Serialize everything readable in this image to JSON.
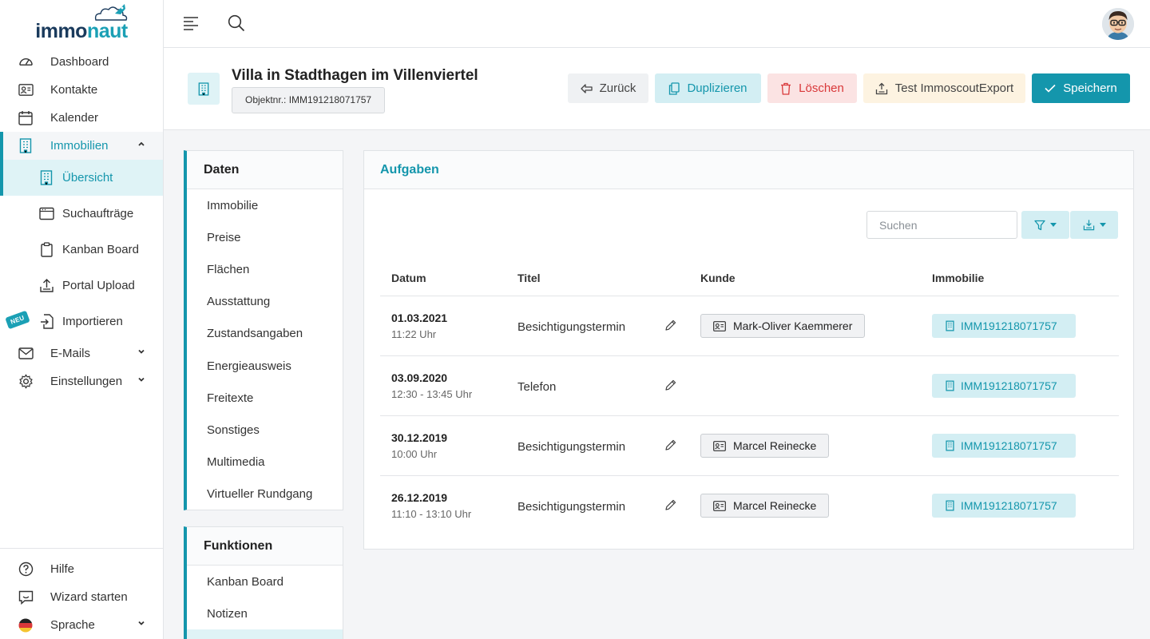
{
  "app": {
    "logo": {
      "prefix": "immo",
      "accent": "naut"
    }
  },
  "sidebar": {
    "items": [
      {
        "label": "Dashboard",
        "icon": "dashboard-icon"
      },
      {
        "label": "Kontakte",
        "icon": "contacts-icon"
      },
      {
        "label": "Kalender",
        "icon": "calendar-icon"
      },
      {
        "label": "Immobilien",
        "icon": "building-icon",
        "expanded": true
      }
    ],
    "sub_items": [
      {
        "label": "Übersicht",
        "icon": "building-icon",
        "active": true
      },
      {
        "label": "Suchaufträge",
        "icon": "search-order-icon"
      },
      {
        "label": "Kanban Board",
        "icon": "clipboard-icon"
      },
      {
        "label": "Portal Upload",
        "icon": "upload-icon"
      },
      {
        "label": "Importieren",
        "icon": "import-icon",
        "badge": "NEU"
      }
    ],
    "items_after": [
      {
        "label": "E-Mails",
        "icon": "mail-icon"
      },
      {
        "label": "Einstellungen",
        "icon": "gear-icon"
      }
    ],
    "bottom": [
      {
        "label": "Hilfe",
        "icon": "help-icon"
      },
      {
        "label": "Wizard starten",
        "icon": "wizard-icon"
      },
      {
        "label": "Sprache",
        "icon": "german-flag-icon"
      }
    ]
  },
  "header": {
    "title": "Villa in Stadthagen im Villenviertel",
    "object_number": "Objektnr.: IMM191218071757",
    "buttons": {
      "back": "Zurück",
      "duplicate": "Duplizieren",
      "delete": "Löschen",
      "test_export": "Test ImmoscoutExport",
      "save": "Speichern"
    }
  },
  "daten": {
    "title": "Daten",
    "items": [
      "Immobilie",
      "Preise",
      "Flächen",
      "Ausstattung",
      "Zustandsangaben",
      "Energieausweis",
      "Freitexte",
      "Sonstiges",
      "Multimedia",
      "Virtueller Rundgang"
    ]
  },
  "funktionen": {
    "title": "Funktionen",
    "items": [
      "Kanban Board",
      "Notizen"
    ]
  },
  "tasks": {
    "title": "Aufgaben",
    "search_placeholder": "Suchen",
    "columns": {
      "datum": "Datum",
      "titel": "Titel",
      "kunde": "Kunde",
      "immobilie": "Immobilie"
    },
    "rows": [
      {
        "date": "01.03.2021",
        "time": "11:22 Uhr",
        "title": "Besichtigungstermin",
        "kunde": "Mark-Oliver Kaemmerer",
        "immobilie": "IMM191218071757"
      },
      {
        "date": "03.09.2020",
        "time": "12:30 - 13:45 Uhr",
        "title": "Telefon",
        "kunde": "",
        "immobilie": "IMM191218071757"
      },
      {
        "date": "30.12.2019",
        "time": "10:00 Uhr",
        "title": "Besichtigungstermin",
        "kunde": "Marcel Reinecke",
        "immobilie": "IMM191218071757"
      },
      {
        "date": "26.12.2019",
        "time": "11:10 - 13:10 Uhr",
        "title": "Besichtigungstermin",
        "kunde": "Marcel Reinecke",
        "immobilie": "IMM191218071757"
      }
    ]
  },
  "colors": {
    "accent": "#1496ac",
    "danger": "#d9383a",
    "brand_dark": "#1a3a5c"
  }
}
